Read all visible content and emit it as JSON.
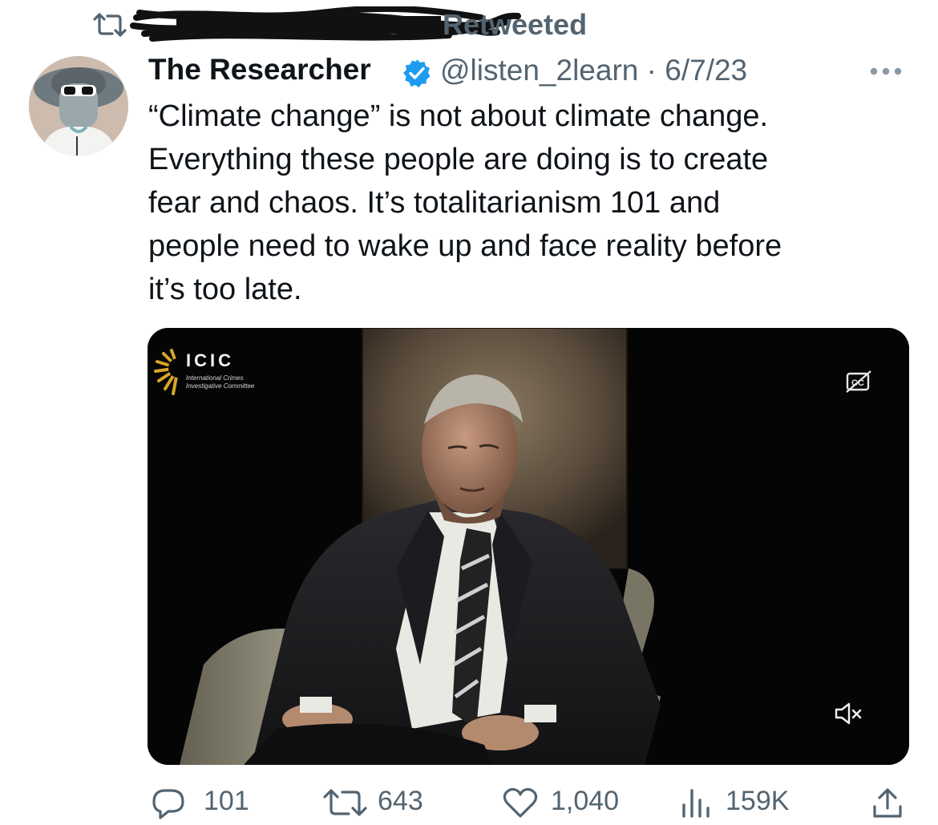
{
  "retweet_banner": {
    "label": "Retweeted",
    "icon": "retweet-icon",
    "retweeter_name": "(redacted by scribble)"
  },
  "author": {
    "display_name": "The Researcher",
    "verified_icon": "verified-badge-icon",
    "handle": "@listen_2learn",
    "separator": "·",
    "date": "6/7/23"
  },
  "tweet": {
    "text": "“Climate change” is not about climate change.\nEverything these people are doing is to create\nfear and chaos. It’s totalitarianism 101 and\npeople need to wake up and face reality before\nit’s too late."
  },
  "media": {
    "type": "video",
    "logo_title": "ICIC",
    "logo_line1": "International Crimes",
    "logo_line2": "Investigative Committee",
    "captions_icon": "captions-off-icon",
    "mute_icon": "muted-speaker-icon"
  },
  "actions": {
    "replies": "101",
    "retweets": "643",
    "likes": "1,040",
    "views": "159K",
    "icons": [
      "reply-icon",
      "retweet-icon",
      "like-icon",
      "views-icon",
      "share-icon"
    ]
  },
  "colors": {
    "text": "#0f1419",
    "secondary": "#536471",
    "verified": "#1d9bf0"
  }
}
